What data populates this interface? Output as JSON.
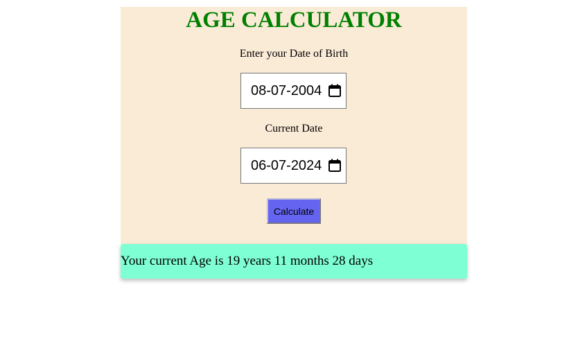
{
  "title": "AGE CALCULATOR",
  "dob": {
    "label": "Enter your Date of Birth",
    "value": "08-07-2004",
    "icon": "calendar-icon"
  },
  "current": {
    "label": "Current Date",
    "value": "06-07-2024",
    "icon": "calendar-icon"
  },
  "calculate_label": "Calculate",
  "result_text": "Your current Age is 19 years 11 months 28 days",
  "colors": {
    "card_background": "#faebd7",
    "title": "#008000",
    "button": "#6464f0",
    "result_background": "#7fffd4"
  }
}
